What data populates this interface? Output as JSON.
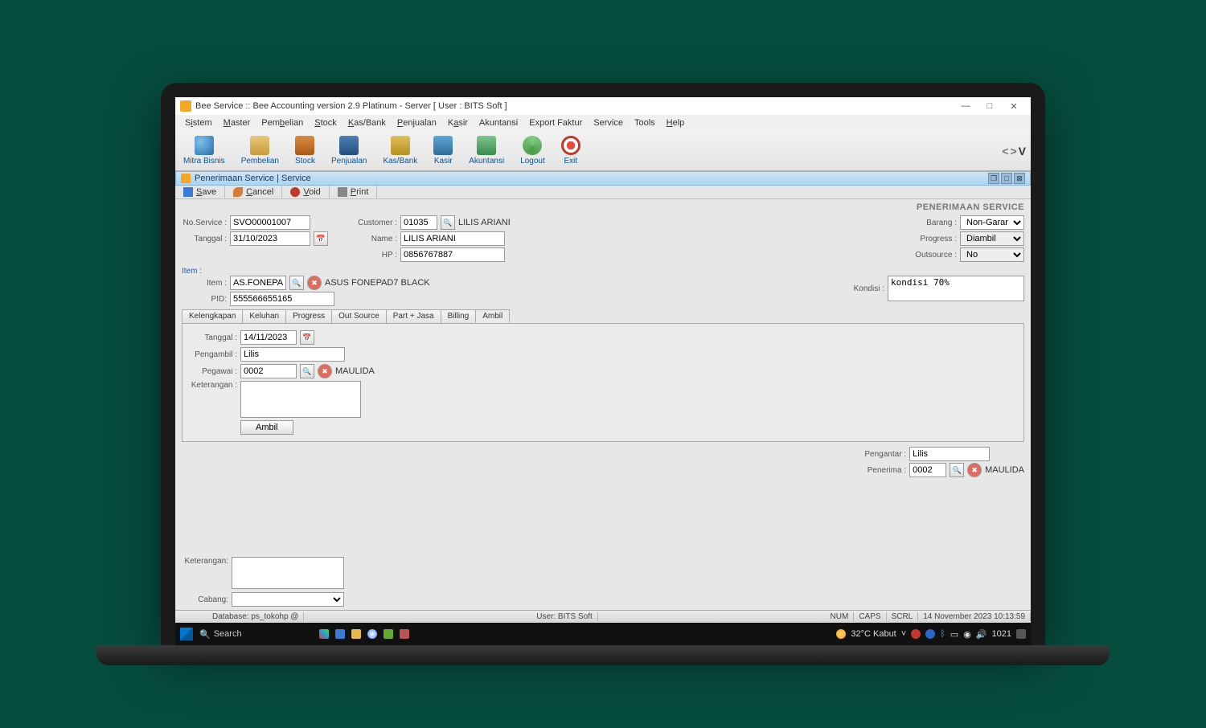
{
  "window": {
    "title": "Bee Service :: Bee Accounting version 2.9 Platinum - Server  [ User : BITS Soft ]"
  },
  "menu": [
    "Sistem",
    "Master",
    "Pembelian",
    "Stock",
    "Kas/Bank",
    "Penjualan",
    "Kasir",
    "Akuntansi",
    "Export Faktur",
    "Service",
    "Tools",
    "Help"
  ],
  "toolbuttons": [
    {
      "label": "Mitra Bisnis",
      "cls": "mb"
    },
    {
      "label": "Pembelian",
      "cls": "pe"
    },
    {
      "label": "Stock",
      "cls": "st"
    },
    {
      "label": "Penjualan",
      "cls": "pj"
    },
    {
      "label": "Kas/Bank",
      "cls": "kb"
    },
    {
      "label": "Kasir",
      "cls": "ks"
    },
    {
      "label": "Akuntansi",
      "cls": "ak"
    },
    {
      "label": "Logout",
      "cls": "lg"
    },
    {
      "label": "Exit",
      "cls": "ex"
    }
  ],
  "inner_window_title": "Penerimaan Service | Service",
  "actions": {
    "save": "Save",
    "cancel": "Cancel",
    "void": "Void",
    "print": "Print"
  },
  "header_caption": "PENERIMAAN SERVICE",
  "form": {
    "no_service_label": "No.Service :",
    "no_service": "SVO00001007",
    "tanggal_label": "Tanggal :",
    "tanggal": "31/10/2023",
    "customer_label": "Customer :",
    "customer_code": "01035",
    "customer_name_inline": "LILIS ARIANI",
    "name_label": "Name :",
    "name": "LILIS ARIANI",
    "hp_label": "HP :",
    "hp": "0856767887",
    "barang_label": "Barang :",
    "barang": "Non-Garansi",
    "progress_label": "Progress :",
    "progress": "Diambil",
    "outsource_label": "Outsource :",
    "outsource": "No",
    "item_section": "Item :",
    "item_label": "Item :",
    "item_code": "AS.FONEPAI",
    "item_name": "ASUS FONEPAD7 BLACK",
    "pid_label": "PID:",
    "pid": "555566655165",
    "kondisi_label": "Kondisi :",
    "kondisi": "kondisi 70%",
    "tabs": [
      "Kelengkapan",
      "Keluhan",
      "Progress",
      "Out Source",
      "Part + Jasa",
      "Billing",
      "Ambil"
    ],
    "ambil_tanggal_label": "Tanggal :",
    "ambil_tanggal": "14/11/2023",
    "pengambil_label": "Pengambil :",
    "pengambil": "Lilis",
    "pegawai_label": "Pegawai :",
    "pegawai_code": "0002",
    "pegawai_name": "MAULIDA",
    "keterangan_label": "Keterangan :",
    "keterangan": "",
    "ambil_btn": "Ambil",
    "pengantar_label": "Pengantar :",
    "pengantar": "Lilis",
    "penerima_label": "Penerima :",
    "penerima_code": "0002",
    "penerima_name": "MAULIDA",
    "keterangan2_label": "Keterangan:",
    "keterangan2": "",
    "cabang_label": "Cabang:",
    "cabang": ""
  },
  "status": {
    "database": "Database: ps_tokohp @",
    "user": "User: BITS Soft",
    "num": "NUM",
    "caps": "CAPS",
    "scrl": "SCRL",
    "datetime": "14 November 2023  10:13:59"
  },
  "taskbar": {
    "search": "Search",
    "weather": "32°C Kabut",
    "time": "1021"
  }
}
